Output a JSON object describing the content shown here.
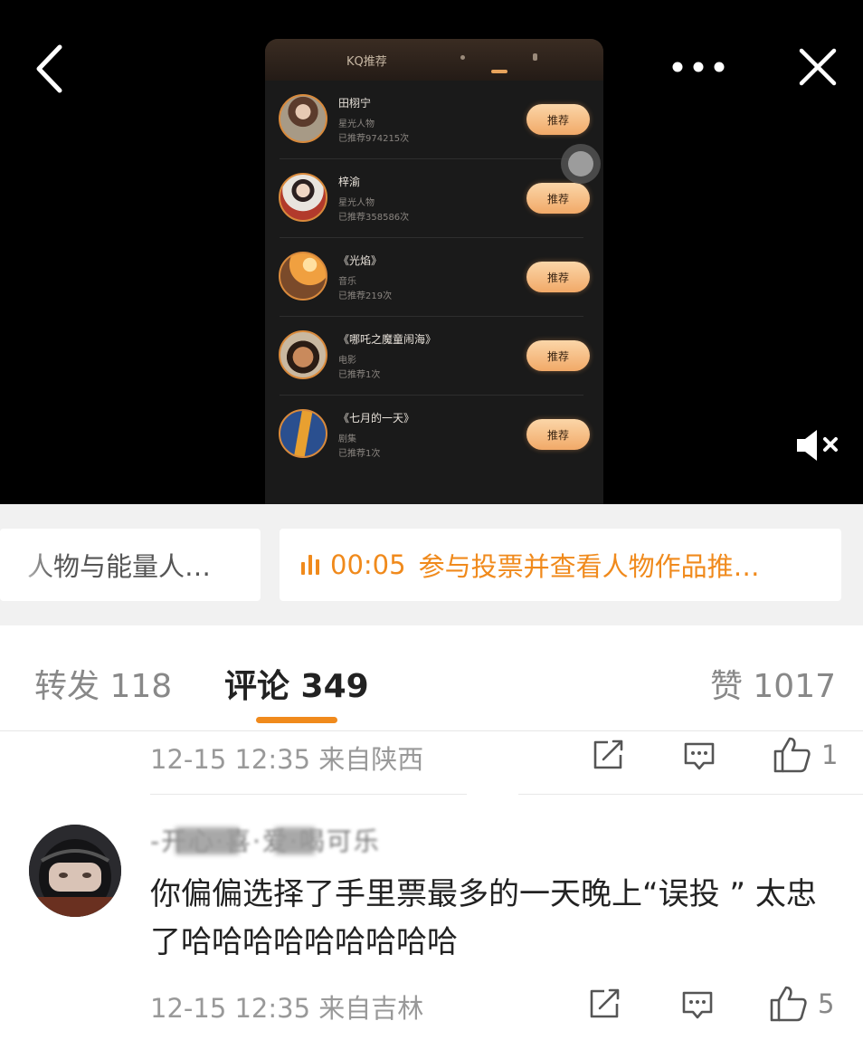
{
  "video": {
    "phone_title": "KQ推荐",
    "recommend_items": [
      {
        "name": "田栩宁",
        "category": "星光人物",
        "count": "已推荐974215次",
        "button": "推荐"
      },
      {
        "name": "梓渝",
        "category": "星光人物",
        "count": "已推荐358586次",
        "button": "推荐"
      },
      {
        "name": "《光焰》",
        "category": "音乐",
        "count": "已推荐219次",
        "button": "推荐"
      },
      {
        "name": "《哪吒之魔童闹海》",
        "category": "电影",
        "count": "已推荐1次",
        "button": "推荐"
      },
      {
        "name": "《七月的一天》",
        "category": "剧集",
        "count": "已推荐1次",
        "button": "推荐"
      }
    ],
    "icons": [
      "back-icon",
      "more-icon",
      "close-icon",
      "mute-icon"
    ]
  },
  "topics": {
    "left_label": "人物与能量人…",
    "audio_time": "00:05",
    "right_label": "参与投票并查看人物作品推…",
    "accent": "#f08a1c"
  },
  "tabs": {
    "repost": "转发 118",
    "comment": "评论 349",
    "like": "赞 1017"
  },
  "comments": [
    {
      "meta": "12-15 12:35  来自陕西",
      "like_count": "1"
    },
    {
      "username": "-开心·喜·爱·喝可乐",
      "text": "你偏偏选择了手里票最多的一天晚上“误投 ” 太忠了哈哈哈哈哈哈哈哈哈",
      "meta": "12-15 12:35  来自吉林",
      "like_count": "5"
    }
  ]
}
